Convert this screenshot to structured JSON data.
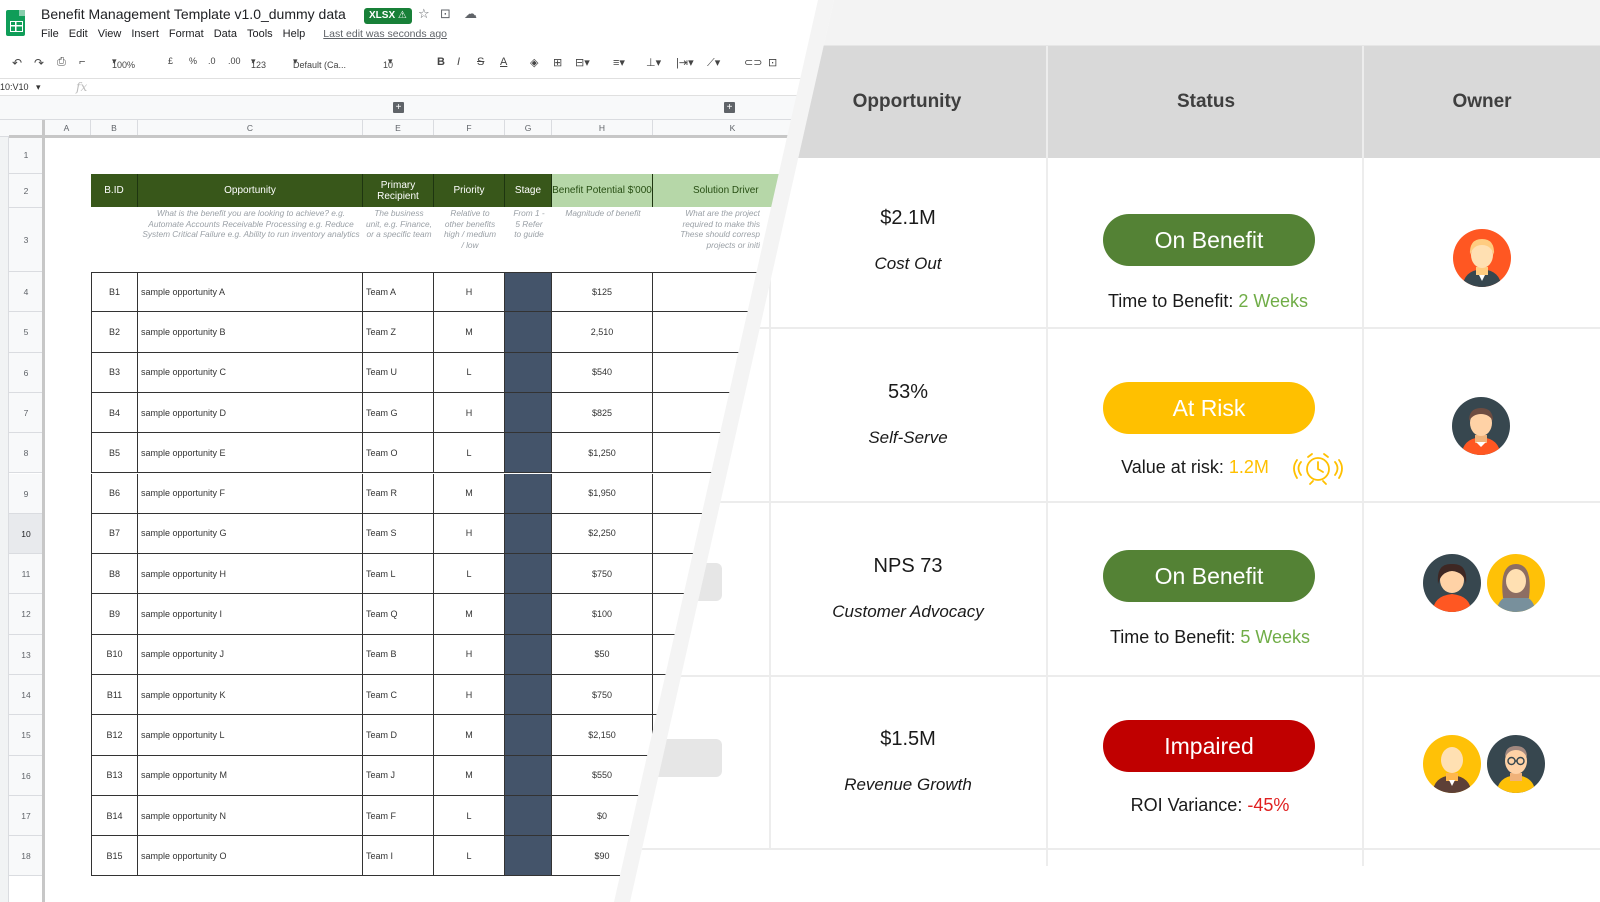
{
  "sheet": {
    "doc_title": "Benefit Management Template v1.0_dummy data",
    "badge": "XLSX",
    "menu": [
      "File",
      "Edit",
      "View",
      "Insert",
      "Format",
      "Data",
      "Tools",
      "Help"
    ],
    "last_edit": "Last edit was seconds ago",
    "toolbar": {
      "zoom": "100%",
      "currency": "£",
      "percent": "%",
      "dec_less": ".0",
      "dec_more": ".00",
      "format_more": "123",
      "font": "Default (Ca...",
      "font_size": "10",
      "bold": "B",
      "italic": "I",
      "strike": "S",
      "text_color": "A"
    },
    "namebox": "10:V10",
    "fx": "fx",
    "columns": [
      "A",
      "B",
      "C",
      "E",
      "F",
      "G",
      "H",
      "K"
    ],
    "row_numbers": [
      "1",
      "2",
      "3",
      "4",
      "5",
      "6",
      "7",
      "8",
      "9",
      "10",
      "11",
      "12",
      "13",
      "14",
      "15",
      "16",
      "17",
      "18"
    ],
    "headers": {
      "bid": "B.ID",
      "opportunity": "Opportunity",
      "recipient": "Primary Recipient",
      "priority": "Priority",
      "stage": "Stage",
      "benefit": "Benefit Potential $'000",
      "driver": "Solution Driver"
    },
    "hints": {
      "opportunity": "What is the benefit you are looking to achieve? e.g. Automate Accounts Receivable Processing e.g. Reduce System Critical Failure e.g. Ability to run inventory analytics",
      "recipient": "The business unit, e.g. Finance, or a specific team",
      "priority": "Relative to other benefits high / medium / low",
      "stage": "From 1 - 5 Refer to guide",
      "benefit": "Magnitude of benefit",
      "driver": "What are the project required to make this These should corresp projects or initi"
    },
    "rows": [
      {
        "id": "B1",
        "opp": "sample opportunity A",
        "team": "Team A",
        "priority": "H",
        "benefit": "$125"
      },
      {
        "id": "B2",
        "opp": "sample opportunity B",
        "team": "Team Z",
        "priority": "M",
        "benefit": "2,510"
      },
      {
        "id": "B3",
        "opp": "sample opportunity C",
        "team": "Team U",
        "priority": "L",
        "benefit": "$540"
      },
      {
        "id": "B4",
        "opp": "sample opportunity D",
        "team": "Team G",
        "priority": "H",
        "benefit": "$825"
      },
      {
        "id": "B5",
        "opp": "sample opportunity E",
        "team": "Team O",
        "priority": "L",
        "benefit": "$1,250"
      },
      {
        "id": "B6",
        "opp": "sample opportunity F",
        "team": "Team R",
        "priority": "M",
        "benefit": "$1,950"
      },
      {
        "id": "B7",
        "opp": "sample opportunity G",
        "team": "Team S",
        "priority": "H",
        "benefit": "$2,250"
      },
      {
        "id": "B8",
        "opp": "sample opportunity H",
        "team": "Team L",
        "priority": "L",
        "benefit": "$750"
      },
      {
        "id": "B9",
        "opp": "sample opportunity I",
        "team": "Team Q",
        "priority": "M",
        "benefit": "$100"
      },
      {
        "id": "B10",
        "opp": "sample opportunity J",
        "team": "Team B",
        "priority": "H",
        "benefit": "$50"
      },
      {
        "id": "B11",
        "opp": "sample opportunity K",
        "team": "Team C",
        "priority": "H",
        "benefit": "$750"
      },
      {
        "id": "B12",
        "opp": "sample opportunity L",
        "team": "Team D",
        "priority": "M",
        "benefit": "$2,150"
      },
      {
        "id": "B13",
        "opp": "sample opportunity M",
        "team": "Team J",
        "priority": "M",
        "benefit": "$550"
      },
      {
        "id": "B14",
        "opp": "sample opportunity N",
        "team": "Team F",
        "priority": "L",
        "benefit": "$0"
      },
      {
        "id": "B15",
        "opp": "sample opportunity O",
        "team": "Team I",
        "priority": "L",
        "benefit": "$90"
      }
    ]
  },
  "dashboard": {
    "headers": {
      "opportunity": "Opportunity",
      "status": "Status",
      "owner": "Owner"
    },
    "rows": [
      {
        "metric": "$2.1M",
        "label": "Cost Out",
        "status": "On Benefit",
        "status_color": "#548235",
        "sub_label": "Time to Benefit:",
        "sub_value": "2 Weeks",
        "sub_color": "#70ad47"
      },
      {
        "metric": "53%",
        "label": "Self-Serve",
        "status": "At Risk",
        "status_color": "#ffc000",
        "sub_label": "Value at risk:",
        "sub_value": "1.2M",
        "sub_color": "#ffc000"
      },
      {
        "metric": "NPS 73",
        "label": "Customer Advocacy",
        "status": "On Benefit",
        "status_color": "#548235",
        "sub_label": "Time to Benefit:",
        "sub_value": "5 Weeks",
        "sub_color": "#70ad47"
      },
      {
        "metric": "$1.5M",
        "label": "Revenue Growth",
        "status": "Impaired",
        "status_color": "#c00000",
        "sub_label": "ROI Variance:",
        "sub_value": "-45%",
        "sub_color": "#e02020"
      }
    ],
    "icons": {
      "alarm": "alarm-clock-icon"
    }
  }
}
